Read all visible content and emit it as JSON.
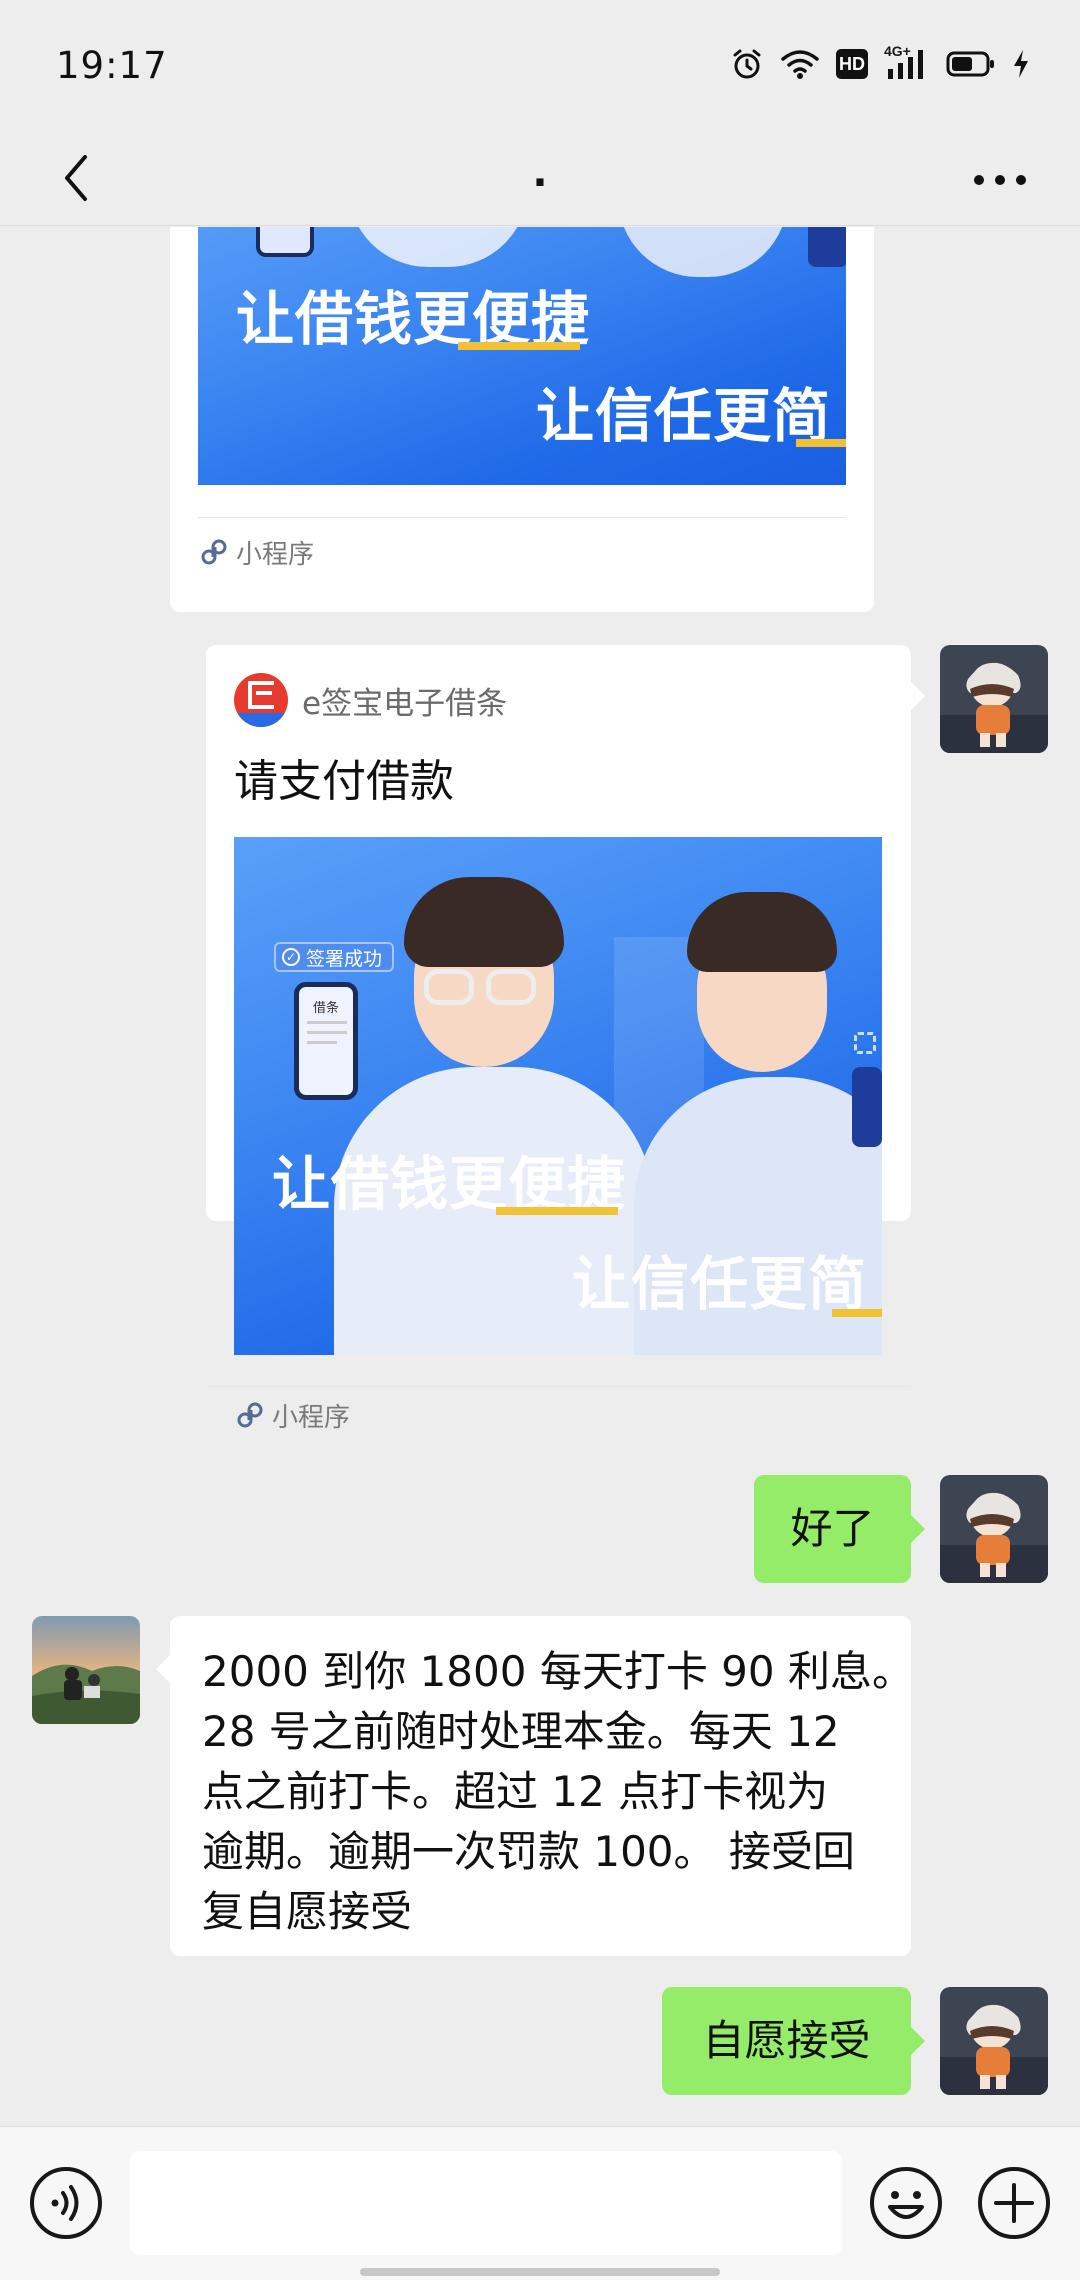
{
  "status_bar": {
    "time": "19:17",
    "icons": [
      "alarm-icon",
      "wifi-icon",
      "hd-badge",
      "4g-signal-icon",
      "battery-icon",
      "charging-icon"
    ],
    "hd_label": "HD",
    "network_label": "4G+"
  },
  "nav": {
    "title": ".",
    "back_icon": "chevron-left-icon",
    "more_icon": "more-dots-icon"
  },
  "messages": [
    {
      "type": "mini_program_card",
      "side": "left",
      "partial": true,
      "banner_line1": "让借钱更便捷",
      "banner_line2": "让信任更简",
      "footer_label": "小程序"
    },
    {
      "type": "mini_program_card",
      "side": "right",
      "app_name": "e签宝电子借条",
      "title": "请支付借款",
      "banner_badge": "签署成功",
      "banner_phone_label": "借条",
      "banner_line1": "让借钱更便捷",
      "banner_line2": "让信任更简",
      "footer_label": "小程序"
    },
    {
      "type": "text",
      "side": "right",
      "text": "好了"
    },
    {
      "type": "text",
      "side": "left",
      "lines": [
        "2000 到你 1800 每天打卡 90 利息。",
        "28 号之前随时处理本金。每天 12",
        "点之前打卡。超过 12 点打卡视为",
        "逾期。逾期一次罚款 100。 接受回",
        "复自愿接受"
      ]
    },
    {
      "type": "text",
      "side": "right",
      "text": "自愿接受"
    }
  ],
  "input_bar": {
    "voice_icon": "voice-icon",
    "input_placeholder": "",
    "emoji_icon": "emoji-icon",
    "plus_icon": "plus-icon"
  },
  "colors": {
    "background": "#ededed",
    "self_bubble": "#95ec69",
    "other_bubble": "#ffffff",
    "banner_blue": "#2f78ee",
    "mini_program_link": "#576b95"
  }
}
